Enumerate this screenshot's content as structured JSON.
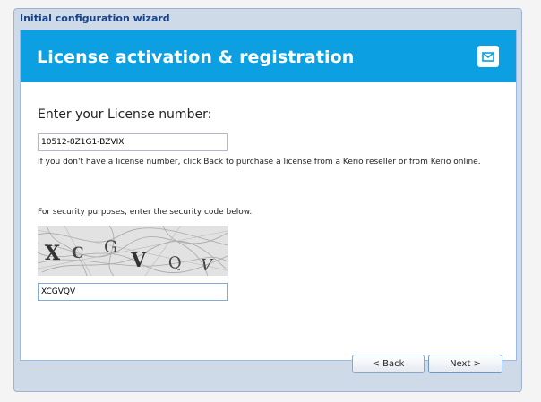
{
  "window": {
    "title": "Initial configuration wizard"
  },
  "banner": {
    "title": "License activation & registration",
    "icon": "envelope-icon"
  },
  "license": {
    "heading": "Enter your License number:",
    "value": "10512-8Z1G1-BZVIX",
    "help": "If you don't have a license number, click Back to purchase a license from a Kerio reseller or from Kerio online."
  },
  "security": {
    "label": "For security purposes, enter the security code below.",
    "captcha_text": "XCGVQV",
    "value": "XCGVQV"
  },
  "buttons": {
    "back": "< Back",
    "next": "Next >"
  },
  "colors": {
    "banner": "#0c9fe1",
    "window": "#cfdae8",
    "title": "#15428b"
  }
}
